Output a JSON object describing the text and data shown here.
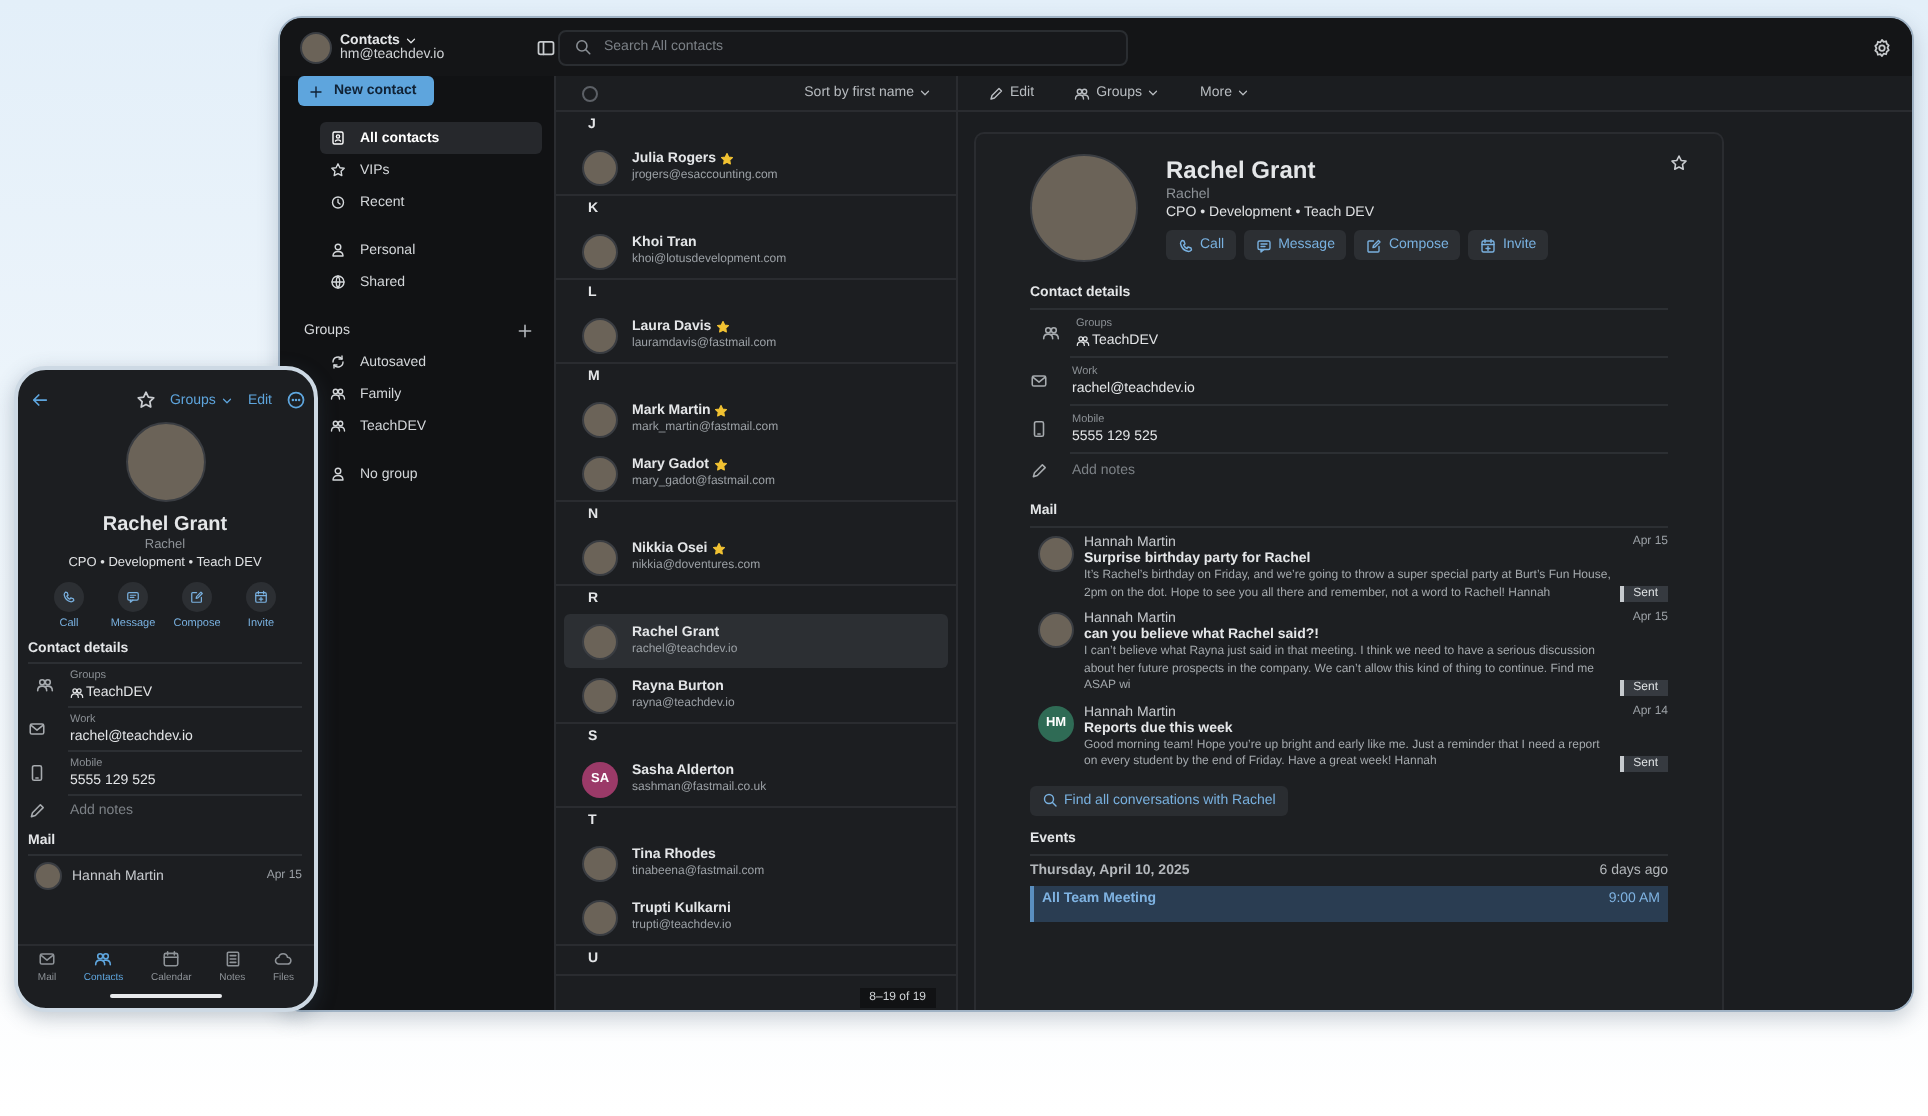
{
  "topbar": {
    "account_title": "Contacts",
    "account_email": "hm@teachdev.io",
    "search": {
      "placeholder": "Search All contacts"
    }
  },
  "sidebar": {
    "new_contact": "New contact",
    "sections": [
      {
        "items": [
          {
            "label": "All contacts",
            "kind": "contacts",
            "selected": true
          },
          {
            "label": "VIPs",
            "kind": "star",
            "selected": false
          },
          {
            "label": "Recent",
            "kind": "recent",
            "selected": false
          }
        ]
      },
      {
        "items": [
          {
            "label": "Personal",
            "kind": "person",
            "selected": false
          },
          {
            "label": "Shared",
            "kind": "shared",
            "selected": false
          }
        ]
      },
      {
        "title": "Groups",
        "items": [
          {
            "label": "Autosaved",
            "kind": "autosaved",
            "selected": false
          },
          {
            "label": "Family",
            "kind": "group",
            "selected": false
          },
          {
            "label": "TeachDEV",
            "kind": "group",
            "selected": false
          }
        ]
      },
      {
        "items": [
          {
            "label": "No group",
            "kind": "person",
            "selected": false
          }
        ]
      }
    ]
  },
  "contact_list": {
    "select_all": {
      "checked": false
    },
    "sort": "Sort by first name",
    "sections": [
      {
        "letter": "J",
        "contacts": [
          {
            "name": "Julia Rogers",
            "email": "jrogers@esaccounting.com",
            "vip": true,
            "selected": false,
            "photo": true
          }
        ]
      },
      {
        "letter": "K",
        "contacts": [
          {
            "name": "Khoi Tran",
            "email": "khoi@lotusdevelopment.com",
            "vip": false,
            "selected": false,
            "photo": true
          }
        ]
      },
      {
        "letter": "L",
        "contacts": [
          {
            "name": "Laura Davis",
            "email": "lauramdavis@fastmail.com",
            "vip": true,
            "selected": false,
            "photo": true
          }
        ]
      },
      {
        "letter": "M",
        "contacts": [
          {
            "name": "Mark Martin",
            "email": "mark_martin@fastmail.com",
            "vip": true,
            "selected": false,
            "photo": true
          },
          {
            "name": "Mary Gadot",
            "email": "mary_gadot@fastmail.com",
            "vip": true,
            "selected": false,
            "photo": true
          }
        ]
      },
      {
        "letter": "N",
        "contacts": [
          {
            "name": "Nikkia Osei",
            "email": "nikkia@doventures.com",
            "vip": true,
            "selected": false,
            "photo": true
          }
        ]
      },
      {
        "letter": "R",
        "contacts": [
          {
            "name": "Rachel Grant",
            "email": "rachel@teachdev.io",
            "vip": false,
            "selected": true,
            "photo": true
          },
          {
            "name": "Rayna Burton",
            "email": "rayna@teachdev.io",
            "vip": false,
            "selected": false,
            "photo": true
          }
        ]
      },
      {
        "letter": "S",
        "contacts": [
          {
            "name": "Sasha Alderton",
            "email": "sashman@fastmail.co.uk",
            "vip": false,
            "selected": false,
            "initials": "SA",
            "color": "#9b3a68"
          }
        ]
      },
      {
        "letter": "T",
        "contacts": [
          {
            "name": "Tina Rhodes",
            "email": "tinabeena@fastmail.com",
            "vip": false,
            "selected": false,
            "photo": true
          },
          {
            "name": "Trupti Kulkarni",
            "email": "trupti@teachdev.io",
            "vip": false,
            "selected": false,
            "photo": true
          }
        ]
      },
      {
        "letter": "U"
      }
    ],
    "pagination": "8–19 of 19"
  },
  "detail": {
    "toolbar": [
      {
        "label": "Edit",
        "kind": "edit"
      },
      {
        "label": "Groups",
        "kind": "groups"
      },
      {
        "label": "More",
        "kind": "more"
      }
    ],
    "contact": {
      "name": "Rachel Grant",
      "nickname": "Rachel",
      "title": "CPO • Development • Teach DEV",
      "favorite": false,
      "actions": [
        {
          "label": "Call",
          "kind": "call"
        },
        {
          "label": "Message",
          "kind": "message"
        },
        {
          "label": "Compose",
          "kind": "compose"
        },
        {
          "label": "Invite",
          "kind": "invite"
        }
      ]
    },
    "details": {
      "title": "Contact details",
      "fields": [
        {
          "kind": "groups",
          "label": "Groups",
          "value": "TeachDEV"
        },
        {
          "kind": "work",
          "label": "Work",
          "value": "rachel@teachdev.io"
        },
        {
          "kind": "mobile",
          "label": "Mobile",
          "value": "5555 129 525"
        }
      ],
      "add_notes": "Add notes"
    },
    "mail": {
      "title": "Mail",
      "messages": [
        {
          "from": "Hannah Martin",
          "date": "Apr 15",
          "subject": "Surprise birthday party for Rachel",
          "preview": "It’s Rachel’s birthday on Friday, and we’re going to throw a super special party at Burt’s Fun House, 2pm on the dot. Hope to see you all there and remember, not a word to Rachel! Hannah",
          "status": "Sent",
          "photo": true
        },
        {
          "from": "Hannah Martin",
          "date": "Apr 15",
          "subject": "can you believe what Rachel said?!",
          "preview": "I can’t believe what Rayna just said in that meeting. I think we need to have a serious discussion about her future prospects in the company. We can’t allow this kind of thing to continue. Find me ASAP wi",
          "status": "Sent",
          "photo": true
        },
        {
          "from": "Hannah Martin",
          "date": "Apr 14",
          "subject": "Reports due this week",
          "preview": "Good morning team! Hope you’re up bright and early like me. Just a reminder that I need a report on every student by the end of Friday. Have a great week! Hannah",
          "status": "Sent",
          "initials": "HM",
          "color": "#2f6b55"
        }
      ],
      "find": "Find all conversations with Rachel"
    },
    "events": {
      "title": "Events",
      "days": [
        {
          "date": "Thursday, April 10, 2025",
          "relative": "6 days ago",
          "items": [
            {
              "title": "All Team Meeting",
              "time": "9:00 AM"
            }
          ]
        }
      ]
    }
  },
  "phone": {
    "toolbar": {
      "favorite": false,
      "groups": "Groups",
      "edit": "Edit"
    },
    "contact": {
      "name": "Rachel Grant",
      "nickname": "Rachel",
      "title": "CPO • Development • Teach DEV",
      "actions": [
        {
          "label": "Call",
          "kind": "call"
        },
        {
          "label": "Message",
          "kind": "message"
        },
        {
          "label": "Compose",
          "kind": "compose"
        },
        {
          "label": "Invite",
          "kind": "invite"
        }
      ]
    },
    "details": {
      "title": "Contact details",
      "fields": [
        {
          "kind": "groups",
          "label": "Groups",
          "value": "TeachDEV"
        },
        {
          "kind": "work",
          "label": "Work",
          "value": "rachel@teachdev.io"
        },
        {
          "kind": "mobile",
          "label": "Mobile",
          "value": "5555 129 525"
        }
      ],
      "add_notes": "Add notes"
    },
    "mail": {
      "title": "Mail",
      "messages": [
        {
          "from": "Hannah Martin",
          "date": "Apr 15",
          "photo": true
        }
      ]
    },
    "tabs": [
      {
        "label": "Mail",
        "kind": "mail",
        "selected": false
      },
      {
        "label": "Contacts",
        "kind": "contacts",
        "selected": true
      },
      {
        "label": "Calendar",
        "kind": "calendar",
        "selected": false
      },
      {
        "label": "Notes",
        "kind": "notes",
        "selected": false
      },
      {
        "label": "Files",
        "kind": "files",
        "selected": false
      }
    ]
  }
}
